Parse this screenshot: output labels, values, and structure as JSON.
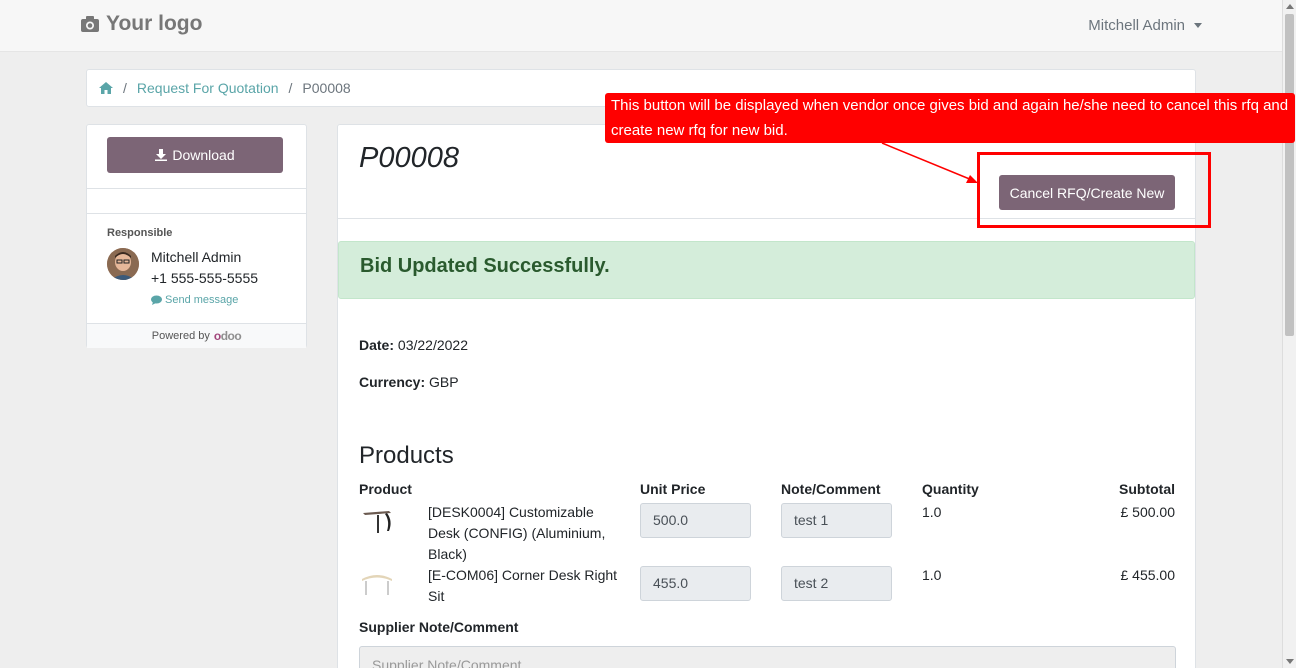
{
  "header": {
    "logo_text": "Your logo",
    "user_name": "Mitchell Admin"
  },
  "breadcrumb": {
    "sep": "/",
    "parent": "Request For Quotation",
    "current": "P00008"
  },
  "sidebar": {
    "download_label": "Download",
    "responsible_label": "Responsible",
    "responsible_name": "Mitchell Admin",
    "responsible_phone": "+1 555-555-5555",
    "send_message_label": "Send message",
    "powered_by": "Powered by",
    "powered_brand": "odoo"
  },
  "main": {
    "order_title": "P00008",
    "cancel_button_label": "Cancel RFQ/Create New",
    "alert_text": "Bid Updated Successfully.",
    "date_label": "Date:",
    "date_value": "03/22/2022",
    "currency_label": "Currency:",
    "currency_value": "GBP",
    "products_title": "Products",
    "columns": {
      "product": "Product",
      "unit_price": "Unit Price",
      "note": "Note/Comment",
      "quantity": "Quantity",
      "subtotal": "Subtotal"
    },
    "rows": [
      {
        "name": "[DESK0004] Customizable Desk (CONFIG) (Aluminium, Black)",
        "unit_price": "500.0",
        "note": "test 1",
        "quantity": "1.0",
        "subtotal": "£ 500.00"
      },
      {
        "name": "[E-COM06] Corner Desk Right Sit",
        "unit_price": "455.0",
        "note": "test 2",
        "quantity": "1.0",
        "subtotal": "£ 455.00"
      }
    ],
    "supplier_label": "Supplier Note/Comment",
    "supplier_placeholder": "Supplier Note/Comment......"
  },
  "annotation": {
    "text": "This button will be displayed when vendor once gives bid and again he/she need to cancel this rfq and create  new rfq for new bid."
  },
  "colors": {
    "primary": "#7c6576",
    "link": "#5aa5a8",
    "alert_bg": "#d4edda",
    "annotation": "#ff0000"
  }
}
